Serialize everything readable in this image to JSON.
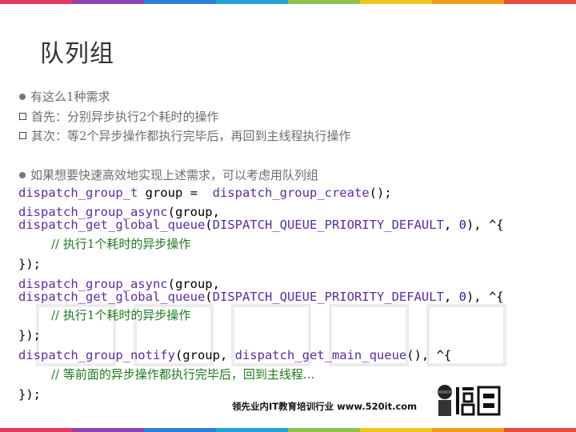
{
  "slide": {
    "title": "队列组"
  },
  "colors": {
    "stripe": [
      "#e83a5d",
      "#8e44ad",
      "#2f7ed8",
      "#25a4d3",
      "#8bc34a",
      "#f0c419",
      "#f39c12",
      "#e74c3c"
    ]
  },
  "bullets": [
    {
      "icon": "dot",
      "text": "有这么1种需求"
    },
    {
      "icon": "square",
      "text": "首先：分别异步执行2个耗时的操作"
    },
    {
      "icon": "square",
      "text": "其次：等2个异步操作都执行完毕后，再回到主线程执行操作"
    },
    {
      "icon": "dot",
      "text": "如果想要快速高效地实现上述需求，可以考虑用队列组"
    }
  ],
  "code": {
    "l1_type": "dispatch_group_t",
    "l1_mid": " group =  ",
    "l1_fn": "dispatch_group_create",
    "l1_end": "();",
    "async_fn": "dispatch_group_async",
    "async_arg": "(group,",
    "get_global": "dispatch_get_global_queue",
    "paren": "(",
    "priority": "DISPATCH_QUEUE_PRIORITY_DEFAULT",
    "comma": ", ",
    "zero": "0",
    "block_open": "), ^{",
    "comment1": "// 执行1个耗时的异步操作",
    "close": "});",
    "notify_fn": "dispatch_group_notify",
    "notify_arg": "(group, ",
    "main_queue": "dispatch_get_main_queue",
    "notify_end": "(), ^{",
    "comment2": "// 等前面的异步操作都执行完毕后，回到主线程..."
  },
  "footer": {
    "text": "领先业内IT教育培训行业 www.520it.com"
  }
}
